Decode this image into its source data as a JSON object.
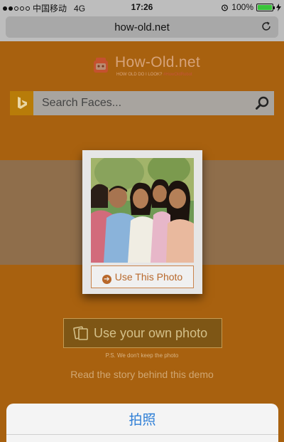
{
  "status_bar": {
    "carrier": "中国移动",
    "network": "4G",
    "time": "17:26",
    "battery": "100%",
    "battery_level": 1.0,
    "signal_bars": 5,
    "signal_filled": 2
  },
  "address_bar": {
    "url": "how-old.net",
    "reload_icon": "reload-icon"
  },
  "page": {
    "logo_text": "How-Old.net",
    "tagline": "HOW OLD DO I LOOK?",
    "tagline_hashtag": "#HowOldRobot",
    "search_placeholder": "Search Faces...",
    "use_this_photo": "Use This Photo",
    "use_own_photo": "Use your own photo",
    "privacy_note": "P.S. We don't keep the photo",
    "story_link": "Read the story behind this demo"
  },
  "action_sheet": {
    "option": "拍照"
  },
  "colors": {
    "page_bg": "#a8610f",
    "accent": "#b8682b",
    "sheet_option": "#2f7fd6"
  }
}
